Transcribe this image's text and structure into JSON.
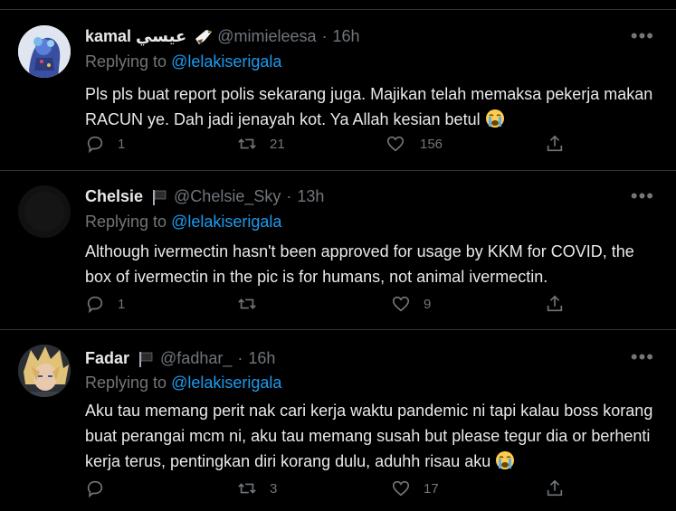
{
  "tweets": [
    {
      "name": "kamal عيسي",
      "handle": "@mimieleesa",
      "time": "16h",
      "reply_prefix": "Replying to",
      "reply_to": "@lelakiserigala",
      "text": "Pls pls buat report polis sekarang juga. Majikan telah memaksa pekerja makan RACUN ye. Dah jadi jenayah kot. Ya Allah kesian betul",
      "replies": "1",
      "retweets": "21",
      "likes": "156",
      "more": "•••"
    },
    {
      "name": "Chelsie",
      "handle": "@Chelsie_Sky",
      "time": "13h",
      "reply_prefix": "Replying to",
      "reply_to": "@lelakiserigala",
      "text": "Although ivermectin hasn't been approved for usage by KKM for COVID, the box of ivermectin in the pic is for humans, not animal ivermectin.",
      "replies": "1",
      "retweets": "",
      "likes": "9",
      "more": "•••"
    },
    {
      "name": "Fadar",
      "handle": "@fadhar_",
      "time": "16h",
      "reply_prefix": "Replying to",
      "reply_to": "@lelakiserigala",
      "text": "Aku tau memang perit nak cari kerja waktu pandemic ni tapi kalau boss korang buat perangai mcm ni, aku tau memang susah but please tegur dia or berhenti kerja terus, pentingkan diri korang dulu, aduhh risau aku",
      "replies": "",
      "retweets": "3",
      "likes": "17",
      "more": "•••"
    }
  ],
  "icons": [
    "reply-icon",
    "retweet-icon",
    "like-icon",
    "share-icon",
    "crying-emoji-icon",
    "flag-icon",
    "eagle-emoji-icon"
  ],
  "colors": {
    "background": "#000000",
    "text": "#e7e9ea",
    "muted": "#71767b",
    "link": "#1d9bf0",
    "divider": "#2f3336"
  }
}
